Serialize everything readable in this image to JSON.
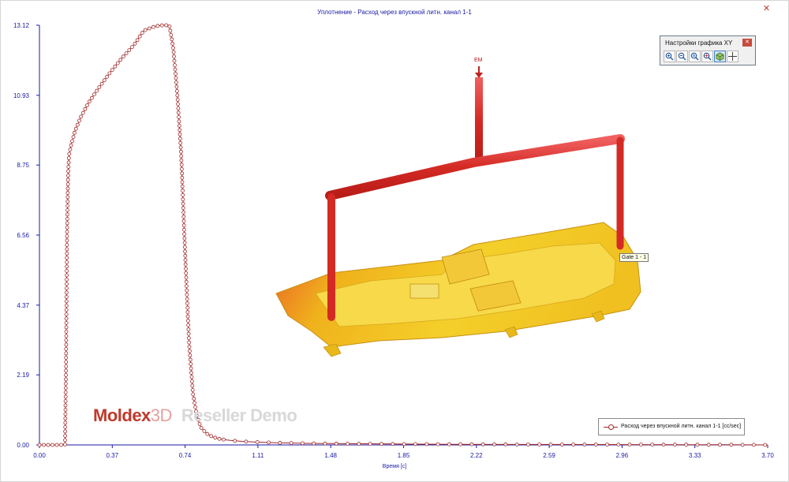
{
  "chart_data": {
    "type": "line",
    "title": "Уплотнение - Расход через впускной литн. канал 1-1",
    "xlabel": "Время [с]",
    "ylabel": "",
    "xlim": [
      0.0,
      3.7
    ],
    "ylim": [
      0.0,
      13.12
    ],
    "x_ticks": [
      "0.00",
      "0.37",
      "0.74",
      "1.11",
      "1.48",
      "1.85",
      "2.22",
      "2.59",
      "2.96",
      "3.33",
      "3.70"
    ],
    "y_ticks": [
      "0.00",
      "2.19",
      "4.37",
      "6.56",
      "8.75",
      "10.93",
      "13.12"
    ],
    "grid": false,
    "legend_position": "bottom-right",
    "series": [
      {
        "name": "Расход через впускной литн. канал 1-1 [cc/sec]",
        "color": "#a02828",
        "x": [
          0.0,
          0.13,
          0.135,
          0.14,
          0.145,
          0.15,
          0.16,
          0.18,
          0.21,
          0.25,
          0.3,
          0.36,
          0.42,
          0.48,
          0.53,
          0.57,
          0.6,
          0.63,
          0.66,
          0.68,
          0.7,
          0.72,
          0.74,
          0.76,
          0.78,
          0.8,
          0.82,
          0.85,
          0.88,
          0.92,
          0.97,
          1.03,
          1.1,
          1.2,
          1.35,
          1.55,
          1.8,
          2.1,
          2.5,
          3.0,
          3.5,
          3.7
        ],
        "values": [
          0.0,
          0.0,
          2.5,
          6.5,
          8.3,
          9.05,
          9.35,
          9.8,
          10.25,
          10.7,
          11.15,
          11.65,
          12.1,
          12.5,
          12.95,
          13.05,
          13.1,
          13.12,
          13.12,
          12.4,
          11.0,
          9.1,
          6.0,
          3.2,
          1.6,
          0.9,
          0.55,
          0.35,
          0.25,
          0.18,
          0.14,
          0.11,
          0.09,
          0.07,
          0.05,
          0.04,
          0.03,
          0.02,
          0.015,
          0.01,
          0.005,
          0.0
        ]
      }
    ]
  },
  "window": {
    "close_icon": "close-icon"
  },
  "watermark": {
    "brand": "Moldex",
    "brand_3d": "3D",
    "subtitle": "Reseller Demo"
  },
  "toolbar": {
    "title": "Настройки графика XY",
    "close_icon": "close-icon",
    "buttons": [
      "zoom-in-icon",
      "zoom-out-icon",
      "zoom-window-icon",
      "zoom-fit-icon",
      "model-view-icon",
      "crosshair-icon"
    ]
  },
  "model": {
    "em_label": "EM",
    "gate_label": "Gate 1 - 1",
    "colors": {
      "runner": "#e03a30",
      "part": "#f2c21a",
      "hot": "#e85a20"
    }
  }
}
